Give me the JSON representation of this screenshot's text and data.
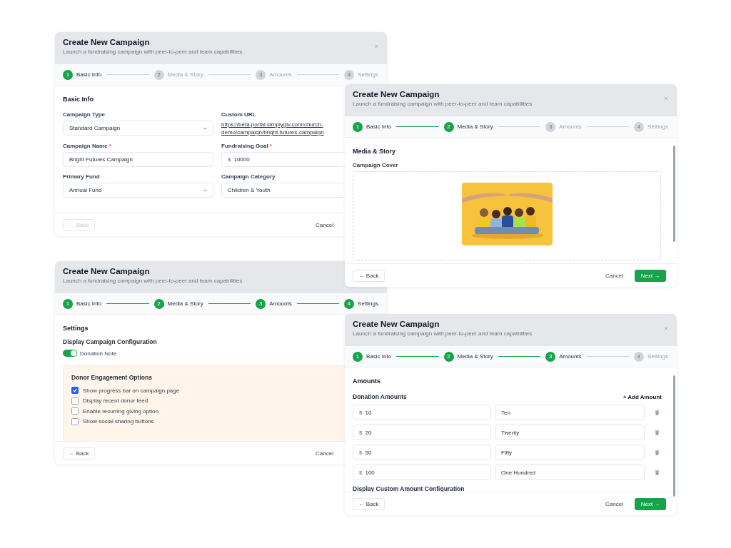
{
  "windows": [
    {
      "kind": "basic",
      "title": "Create New Campaign",
      "subtitle": "Launch a fundraising campaign with peer-to-peer and team capabilities",
      "steps": [
        {
          "number": "1",
          "label": "Basic Info",
          "reached": true
        },
        {
          "number": "2",
          "label": "Media & Story",
          "reached": false
        },
        {
          "number": "3",
          "label": "Amounts",
          "reached": false
        },
        {
          "number": "4",
          "label": "Settings",
          "reached": false
        }
      ],
      "section_title": "Basic Info",
      "fields": [
        {
          "kind": "select",
          "label": "Campaign Type",
          "value": "Standard Campaign"
        },
        {
          "kind": "link",
          "label": "Custom URL",
          "value": "https://beta.portal.simplygiv.com/church-demo/campaign/bright-futures-campaign"
        },
        {
          "kind": "text",
          "label": "Campaign Name",
          "required_mark": "*",
          "value": "Bright Futures Campaign"
        },
        {
          "kind": "money",
          "label": "Fundraising Goal",
          "required_mark": "*",
          "currency": "$",
          "value": "10000"
        },
        {
          "kind": "select",
          "label": "Primary Fund",
          "value": "Annual Fund"
        },
        {
          "kind": "text",
          "label": "Campaign Category",
          "value": "Children & Youth"
        }
      ],
      "footer": {
        "back": "← Back",
        "back_disabled": true,
        "cancel": "Cancel"
      }
    },
    {
      "kind": "media",
      "title": "Create New Campaign",
      "subtitle": "Launch a fundraising campaign with peer-to-peer and team capabilities",
      "steps": [
        {
          "number": "1",
          "label": "Basic Info",
          "reached": true
        },
        {
          "number": "2",
          "label": "Media & Story",
          "reached": true
        },
        {
          "number": "3",
          "label": "Amounts",
          "reached": false
        },
        {
          "number": "4",
          "label": "Settings",
          "reached": false
        }
      ],
      "section_title": "Media & Story",
      "cover_label": "Campaign Cover",
      "footer": {
        "back": "← Back",
        "back_disabled": false,
        "cancel": "Cancel",
        "next": "Next →"
      }
    },
    {
      "kind": "settings",
      "title": "Create New Campaign",
      "subtitle": "Launch a fundraising campaign with peer-to-peer and team capabilities",
      "steps": [
        {
          "number": "1",
          "label": "Basic Info",
          "reached": true
        },
        {
          "number": "2",
          "label": "Media & Story",
          "reached": true
        },
        {
          "number": "3",
          "label": "Amounts",
          "reached": true
        },
        {
          "number": "4",
          "label": "Settings",
          "reached": true
        }
      ],
      "section_title": "Settings",
      "config_title": "Display Campaign Configuration",
      "toggle": {
        "label": "Donation Note",
        "on": true
      },
      "panel": {
        "title": "Donor Engagement Options",
        "options": [
          {
            "label": "Show progress bar on campaign page",
            "checked": true
          },
          {
            "label": "Display recent donor feed",
            "checked": false
          },
          {
            "label": "Enable recurring giving option",
            "checked": false
          },
          {
            "label": "Show social sharing buttons",
            "checked": false
          }
        ]
      },
      "footer": {
        "back": "← Back",
        "back_disabled": false,
        "cancel": "Cancel"
      }
    },
    {
      "kind": "amounts",
      "title": "Create New Campaign",
      "subtitle": "Launch a fundraising campaign with peer-to-peer and team capabilities",
      "steps": [
        {
          "number": "1",
          "label": "Basic Info",
          "reached": true
        },
        {
          "number": "2",
          "label": "Media & Story",
          "reached": true
        },
        {
          "number": "3",
          "label": "Amounts",
          "reached": true
        },
        {
          "number": "4",
          "label": "Settings",
          "reached": false
        }
      ],
      "section_title": "Amounts",
      "amounts_title": "Donation Amounts",
      "add_label": "+ Add Amount",
      "rows": [
        {
          "currency": "$",
          "amount": "10",
          "label": "Ten"
        },
        {
          "currency": "$",
          "amount": "20",
          "label": "Twenty"
        },
        {
          "currency": "$",
          "amount": "50",
          "label": "Fifty"
        },
        {
          "currency": "$",
          "amount": "100",
          "label": "One Hundred"
        }
      ],
      "custom_title": "Display Custom Amount Configuration",
      "footer": {
        "back": "← Back",
        "back_disabled": false,
        "cancel": "Cancel",
        "next": "Next →"
      }
    }
  ]
}
